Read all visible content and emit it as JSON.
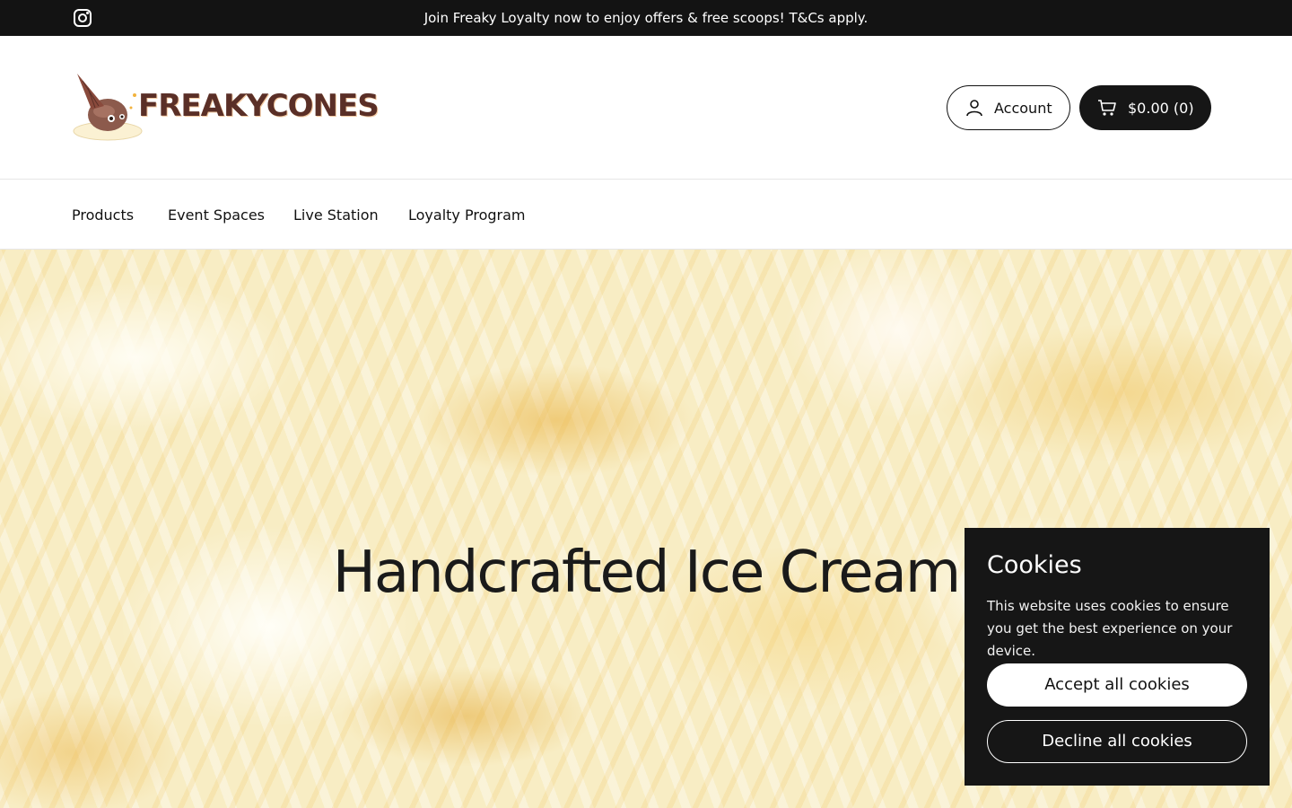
{
  "announcement": {
    "social_icon": "instagram-icon",
    "text": "Join Freaky Loyalty now to enjoy offers & free scoops! T&Cs apply."
  },
  "header": {
    "logo_text": "FREAKYCONES",
    "account_label": "Account",
    "account_icon": "user-icon",
    "cart_label": "$0.00 (0)",
    "cart_icon": "shopping-cart-icon"
  },
  "nav": {
    "items": [
      "Products",
      "Event Spaces",
      "Live Station",
      "Loyalty Program"
    ]
  },
  "hero": {
    "title": "Handcrafted Ice Cream"
  },
  "cookies": {
    "title": "Cookies",
    "text": "This website uses cookies to ensure you get the best experience on your device.",
    "accept_label": "Accept all cookies",
    "decline_label": "Decline all cookies"
  },
  "colors": {
    "topbar": "#131313",
    "brand_brown": "#5a2f27",
    "cookie_bg": "#161616"
  }
}
